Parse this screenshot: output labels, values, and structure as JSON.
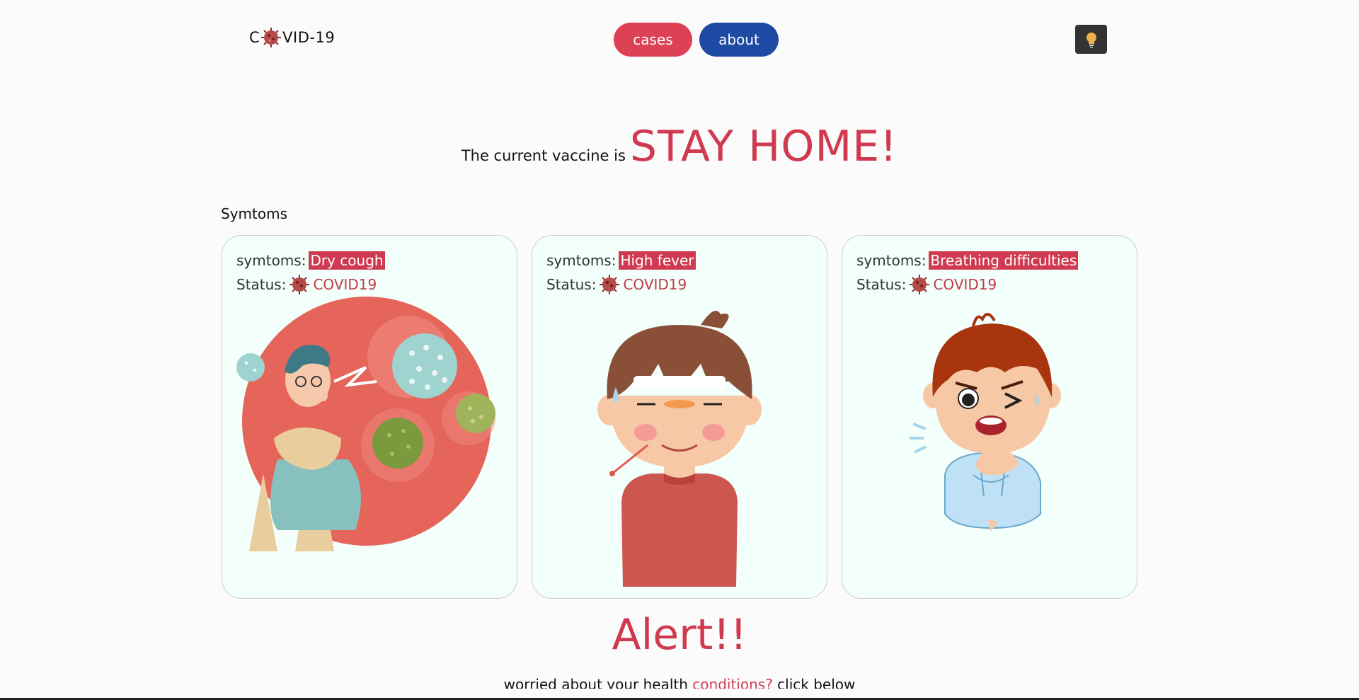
{
  "header": {
    "logo_prefix": "C",
    "logo_suffix": "VID-19",
    "nav": {
      "cases": "cases",
      "about": "about"
    },
    "toggle_icon": "lightbulb-icon"
  },
  "hero": {
    "lead": "The current vaccine is",
    "big": "STAY HOME!"
  },
  "section": {
    "title": "Symtoms"
  },
  "cards": [
    {
      "sym_label": "symtoms:",
      "sym_value": "Dry cough",
      "status_label": "Status:",
      "status_value": "COVID19"
    },
    {
      "sym_label": "symtoms:",
      "sym_value": "High fever",
      "status_label": "Status:",
      "status_value": "COVID19"
    },
    {
      "sym_label": "symtoms:",
      "sym_value": "Breathing difficulties",
      "status_label": "Status:",
      "status_value": "COVID19"
    }
  ],
  "alert": {
    "title": "Alert!!"
  },
  "footer": {
    "text_before": "worried about your health ",
    "accent": "conditions?",
    "text_after": " click below"
  },
  "colors": {
    "accent_red": "#d03a50",
    "nav_blue": "#1e4aa3",
    "nav_red": "#dd4155",
    "card_bg": "#f2fffb"
  }
}
